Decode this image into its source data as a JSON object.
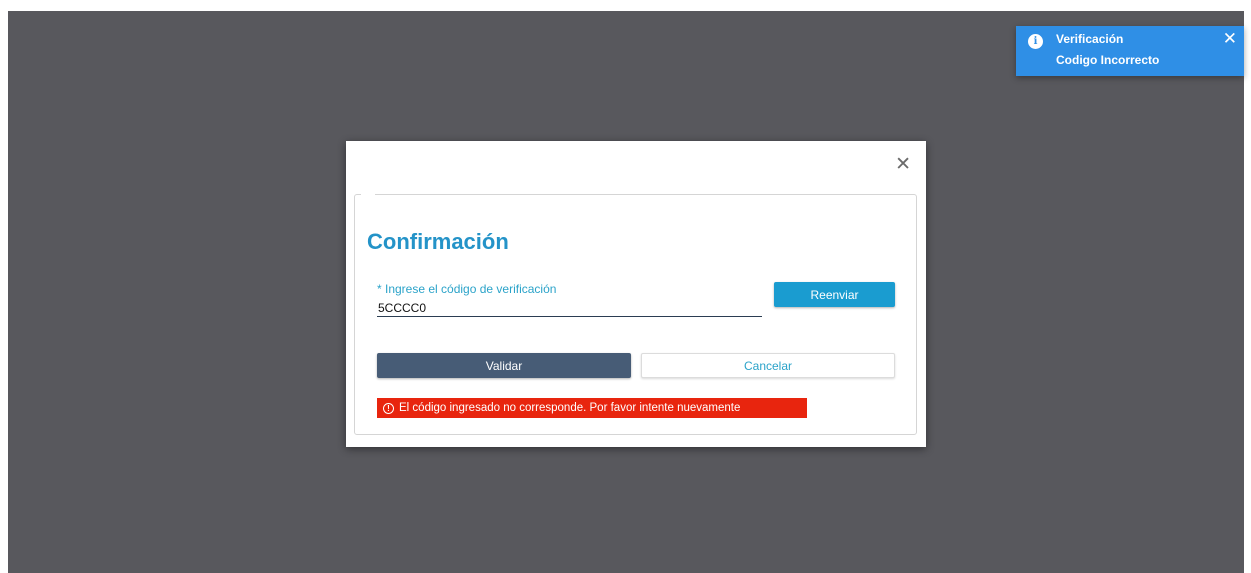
{
  "toast": {
    "icon": "info-icon",
    "icon_glyph": "i",
    "title": "Verificación",
    "message": "Codigo Incorrecto",
    "close_glyph": "✕",
    "color": "#2f8fe6"
  },
  "modal": {
    "close_glyph": "✕",
    "title": "Confirmación",
    "field": {
      "label": "* Ingrese el código de verificación",
      "value": "5CCCC0"
    },
    "resend_label": "Reenviar",
    "validate_label": "Validar",
    "cancel_label": "Cancelar",
    "error": {
      "icon": "alert-circle-icon",
      "icon_glyph": "!",
      "message": "El código ingresado no corresponde. Por favor intente nuevamente",
      "color": "#e8250e"
    },
    "accent_color": "#2493c8"
  }
}
